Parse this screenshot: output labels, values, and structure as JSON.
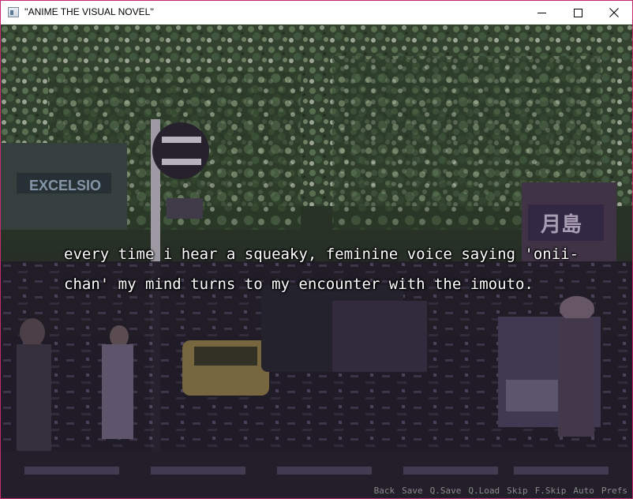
{
  "window": {
    "title": "''ANIME THE VISUAL NOVEL''",
    "icon": "app-window-icon"
  },
  "controls": {
    "minimize_icon": "minimize-icon",
    "maximize_icon": "maximize-icon",
    "close_icon": "close-icon"
  },
  "scene": {
    "background_description_icon": "street-scene-image",
    "sign_text": "EXCELSIO",
    "sign_text_jp": "月島"
  },
  "dialogue": {
    "text": "every time i hear a squeaky, feminine voice saying 'onii-chan' my mind turns to my encounter with the imouto."
  },
  "quick_menu": {
    "items": [
      "Back",
      "Save",
      "Q.Save",
      "Q.Load",
      "Skip",
      "F.Skip",
      "Auto",
      "Prefs"
    ]
  },
  "colors": {
    "window_border": "#c42b6e",
    "dialogue_text": "#ffffff",
    "quick_menu_text": "#8a8a8a"
  }
}
